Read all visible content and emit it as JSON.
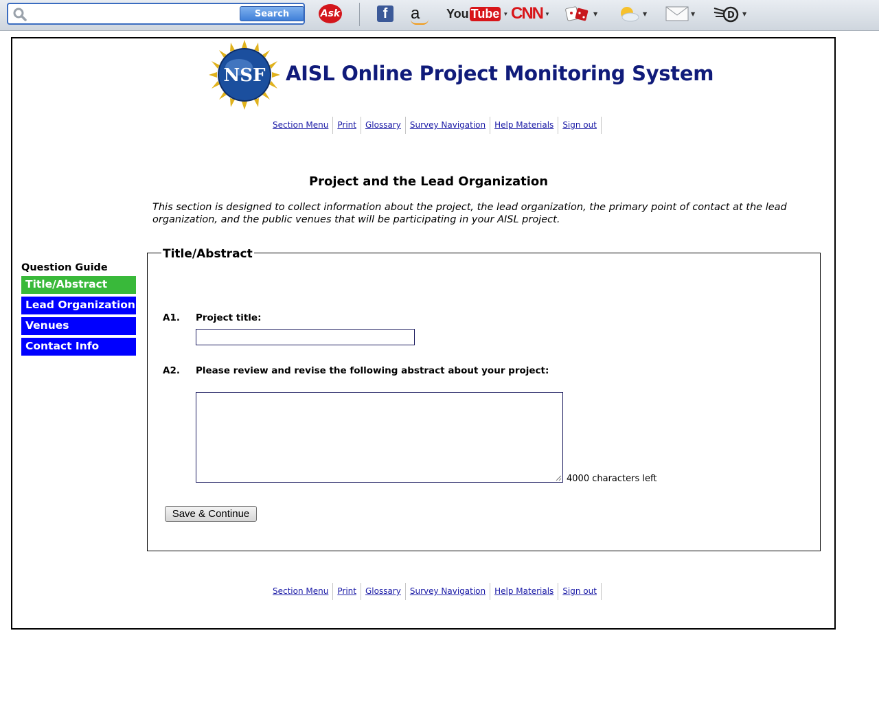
{
  "toolbar": {
    "search_button": "Search",
    "search_placeholder": "",
    "ask_label": "Ask",
    "facebook_label": "f",
    "amazon_label": "a",
    "youtube_you": "You",
    "youtube_tube": "Tube",
    "cnn_label": "CNN",
    "icons": [
      "search-icon",
      "ask-icon",
      "facebook-icon",
      "amazon-icon",
      "youtube-icon",
      "cnn-icon",
      "dice-icon",
      "weather-icon",
      "mail-icon",
      "d-icon"
    ]
  },
  "header": {
    "logo_text": "NSF",
    "site_title": "AISL Online Project Monitoring System"
  },
  "nav": {
    "items": [
      "Section Menu",
      "Print",
      "Glossary",
      "Survey Navigation",
      "Help Materials",
      "Sign out"
    ]
  },
  "page": {
    "title": "Project and the Lead Organization",
    "intro": "This section is designed to collect information about the project, the lead organization, the primary point of contact at the lead organization, and the public venues that will be participating in your AISL project."
  },
  "guide": {
    "label": "Question Guide",
    "items": [
      {
        "label": "Title/Abstract",
        "active": true
      },
      {
        "label": "Lead Organization",
        "active": false
      },
      {
        "label": "Venues",
        "active": false
      },
      {
        "label": "Contact Info",
        "active": false
      }
    ]
  },
  "form": {
    "legend": "Title/Abstract",
    "q1_num": "A1.",
    "q1_text": "Project title:",
    "q1_value": "",
    "q2_num": "A2.",
    "q2_text": "Please review and revise the following abstract about your project:",
    "q2_value": "",
    "chars_left": "4000 characters left",
    "save_label": "Save & Continue"
  },
  "colors": {
    "guide_active": "#39b93a",
    "guide_inactive": "#0000ff",
    "title_blue": "#101b7a",
    "link": "#1a1aa6"
  }
}
